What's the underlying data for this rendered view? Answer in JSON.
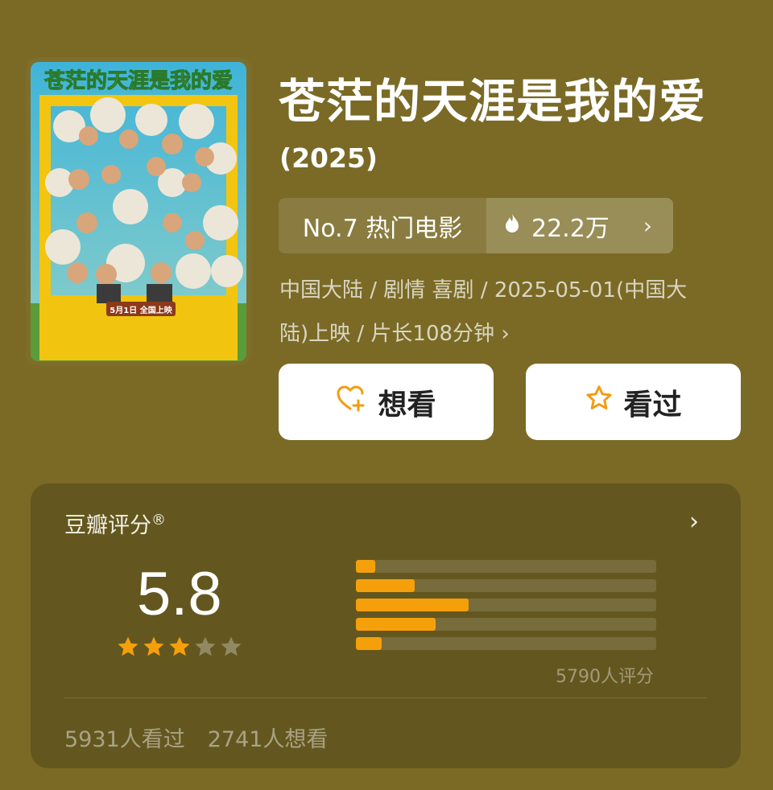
{
  "movie": {
    "title": "苍茫的天涯是我的爱",
    "year": "(2025)",
    "poster_title": "苍茫的天涯是我的爱",
    "poster_date": "5月1日 全国上映"
  },
  "rank": {
    "label": "No.7 热门电影",
    "heat": "22.2万"
  },
  "meta_line1": "中国大陆 / 剧情 喜剧 / 2025-05-01(中国大",
  "meta_line2": "陆)上映 / 片长108分钟 ›",
  "buttons": {
    "want": "想看",
    "seen": "看过"
  },
  "rating": {
    "title": "豆瓣评分",
    "trademark": "®",
    "score": "5.8",
    "score_stars_fraction": 0.6,
    "distribution": [
      {
        "stars": 5,
        "percent": 6.5
      },
      {
        "stars": 4,
        "percent": 19.5
      },
      {
        "stars": 3,
        "percent": 37.5
      },
      {
        "stars": 2,
        "percent": 26.5
      },
      {
        "stars": 1,
        "percent": 8.5
      }
    ],
    "count": "5790人评分",
    "seen_count": "5931人看过",
    "want_count": "2741人想看"
  },
  "colors": {
    "background": "#7a6a26",
    "card": "#63571f",
    "accent": "#f5a00b"
  }
}
